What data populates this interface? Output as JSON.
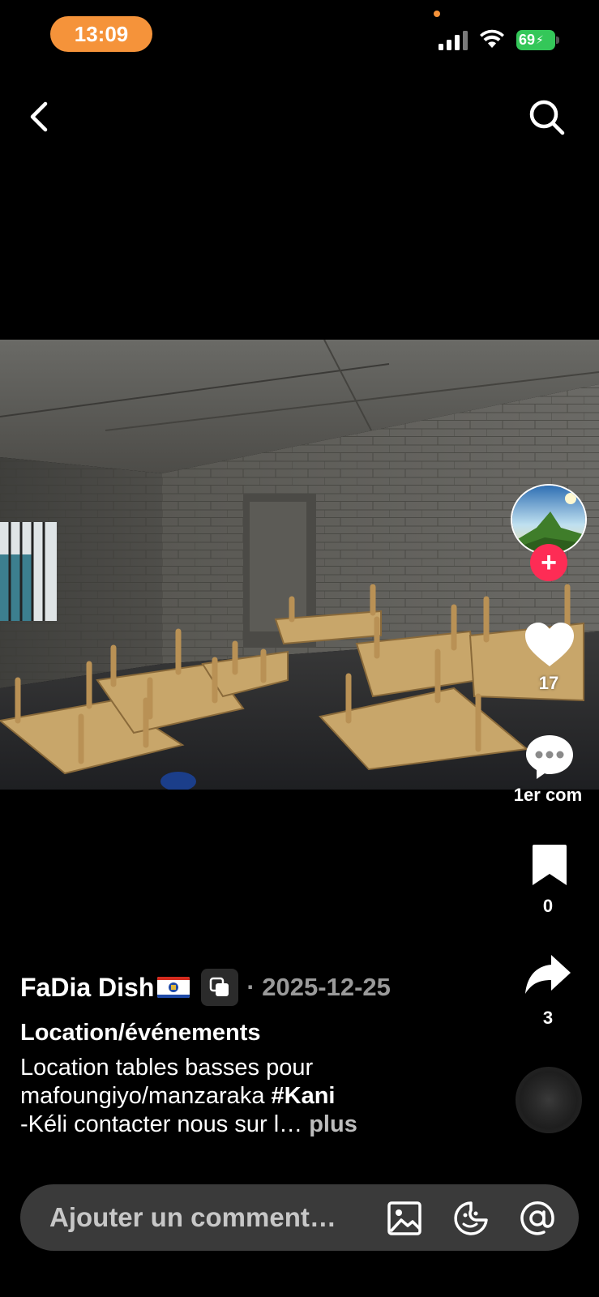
{
  "status_bar": {
    "time": "13:09",
    "battery": "69",
    "battery_color": "#34c759",
    "time_pill_color": "#f5933a"
  },
  "nav": {
    "back_icon": "chevron-left-icon",
    "search_icon": "search-icon"
  },
  "rail": {
    "likes": "17",
    "comments": "1er com",
    "saves": "0",
    "shares": "3",
    "follow_color": "#fe2c55"
  },
  "post": {
    "author": "FaDia Dish",
    "date": "· 2025-12-25",
    "category": "Location/événements",
    "caption_line1": "Location tables basses pour",
    "caption_line2_text": "mafoungiyo/manzaraka ",
    "caption_hashtag": "#Kani",
    "caption_line3": "-Kéli contacter nous sur l… ",
    "more": "plus"
  },
  "comment_bar": {
    "placeholder": "Ajouter un comment…"
  }
}
